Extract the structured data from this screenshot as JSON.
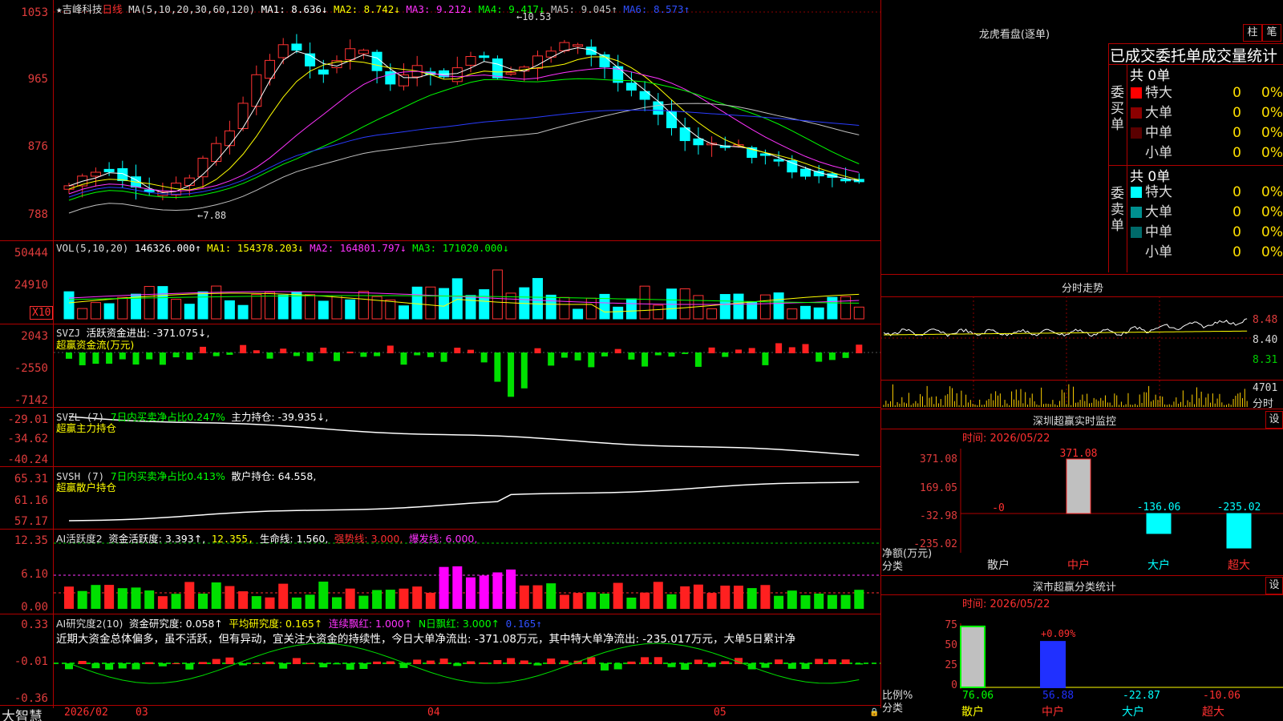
{
  "stock": {
    "name": "吉峰科技",
    "period": "日线"
  },
  "main_header": {
    "star": "★",
    "ma_params": "MA(5,10,20,30,60,120)",
    "ma1": "MA1: 8.636↓",
    "ma2": "MA2: 8.742↓",
    "ma3": "MA3: 9.212↓",
    "ma4": "MA4: 9.417↓",
    "ma5": "MA5: 9.045↑",
    "ma6": "MA6: 8.573↑"
  },
  "price_axis": [
    "1053",
    "965",
    "876",
    "788"
  ],
  "price_marks": {
    "high": "10.53",
    "low": "7.88"
  },
  "vol_header": {
    "title": "VOL(5,10,20)",
    "value": "146326.000↑",
    "ma1": "MA1: 154378.203↓",
    "ma2": "MA2: 164801.797↓",
    "ma3": "MA3: 171020.000↓"
  },
  "vol_axis": [
    "50444",
    "24910"
  ],
  "vol_unit": "X10",
  "svzj_header": {
    "title": "SVZJ",
    "label": "活跃资金进出: -371.075↓,",
    "sub": "超赢资金流(万元)"
  },
  "svzj_axis": [
    "2043",
    "-2550",
    "-7142"
  ],
  "svzl_header": {
    "title": "SVZL (7)",
    "label": "7日内买卖净占比0.247%",
    "value": "主力持仓: -39.935↓,",
    "sub": "超赢主力持仓"
  },
  "svzl_axis": [
    "-29.01",
    "-34.62",
    "-40.24"
  ],
  "svsh_header": {
    "title": "SVSH (7)",
    "label": "7日内买卖净占比0.413%",
    "value": "散户持仓: 64.558,",
    "sub": "超赢散户持仓"
  },
  "svsh_axis": [
    "65.31",
    "61.16",
    "57.17"
  ],
  "ai1_header": {
    "title": "AI活跃度2",
    "label": "资金活跃度: 3.393↑,",
    "v2": "12.355,",
    "v3": "生命线: 1.560,",
    "v4": "强势线: 3.000,",
    "v5": "爆发线: 6.000,"
  },
  "ai1_axis": [
    "12.35",
    "6.10",
    "0.00"
  ],
  "ai2_header": {
    "title": "AI研究度2(10)",
    "v1": "资金研究度: 0.058↑",
    "v2": "平均研究度: 0.165↑",
    "v3": "连续飘红: 1.000↑",
    "v4": "N日飘红: 3.000↑",
    "v5": "0.165↑"
  },
  "ai2_text": "近期大资金总体偏多，虽不活跃，但有异动，宜关注大资金的持续性，今日大单净流出: -371.08万元，其中特大单净流出: -235.017万元，大单5日累计净",
  "ai2_axis": [
    "0.33",
    "-0.01",
    "-0.36"
  ],
  "date_axis": [
    "2026/02",
    "03",
    "04",
    "05"
  ],
  "brand": "大智慧",
  "lh": {
    "title": "龙虎看盘(逐单)",
    "btn1": "柱",
    "btn2": "笔",
    "heading": "已成交委托单成交量统计",
    "buy_label": "委买单",
    "sell_label": "委卖单",
    "buy_total": "共 0单",
    "sell_total": "共 0单",
    "buy_rows": [
      {
        "name": "特大",
        "v": "0",
        "p": "0%",
        "color": "#ff0000"
      },
      {
        "name": "大单",
        "v": "0",
        "p": "0%",
        "color": "#8b0000"
      },
      {
        "name": "中单",
        "v": "0",
        "p": "0%",
        "color": "#5a0000"
      },
      {
        "name": "小单",
        "v": "0",
        "p": "0%",
        "color": "#000000"
      }
    ],
    "sell_rows": [
      {
        "name": "特大",
        "v": "0",
        "p": "0%",
        "color": "#00ffff"
      },
      {
        "name": "大单",
        "v": "0",
        "p": "0%",
        "color": "#009090"
      },
      {
        "name": "中单",
        "v": "0",
        "p": "0%",
        "color": "#006a6a"
      },
      {
        "name": "小单",
        "v": "0",
        "p": "0%",
        "color": "#000000"
      }
    ]
  },
  "fs": {
    "title": "分时走势",
    "axis": [
      "8.48",
      "8.40",
      "8.31"
    ],
    "vol_axis": "4701",
    "vol_unit": "分时"
  },
  "monitor": {
    "title": "深圳超赢实时监控",
    "btn": "设",
    "time": "时间: 2026/05/22",
    "axis": [
      "371.08",
      "169.05",
      "-32.98",
      "-235.02"
    ],
    "unit": "净额(万元)",
    "cat_label": "分类",
    "categories": [
      "散户",
      "中户",
      "大户",
      "超大"
    ],
    "values": [
      0,
      371.08,
      -136.06,
      -235.02
    ],
    "value_labels": [
      "-0",
      "371.08",
      "-136.06",
      "-235.02"
    ]
  },
  "classify": {
    "title": "深市超赢分类统计",
    "btn": "设",
    "time": "时间: 2026/05/22",
    "axis": [
      "75",
      "50",
      "25",
      "0"
    ],
    "unit": "比例%",
    "cat_label": "分类",
    "categories": [
      "散户",
      "中户",
      "大户",
      "超大"
    ],
    "values": [
      76.06,
      56.88,
      -22.87,
      -10.06
    ],
    "value_labels": [
      "76.06",
      "56.88",
      "-22.87",
      "-10.06"
    ],
    "top_label": "+0.09%"
  },
  "chart_data": [
    {
      "type": "bar",
      "title": "深圳超赢实时监控",
      "ylabel": "净额(万元)",
      "categories": [
        "散户",
        "中户",
        "大户",
        "超大"
      ],
      "values": [
        0,
        371.08,
        -136.06,
        -235.02
      ],
      "ylim": [
        -235.02,
        371.08
      ]
    },
    {
      "type": "bar",
      "title": "深市超赢分类统计",
      "ylabel": "比例%",
      "categories": [
        "散户",
        "中户",
        "大户",
        "超大"
      ],
      "values": [
        76.06,
        56.88,
        -22.87,
        -10.06
      ],
      "ylim": [
        0,
        75
      ]
    }
  ]
}
